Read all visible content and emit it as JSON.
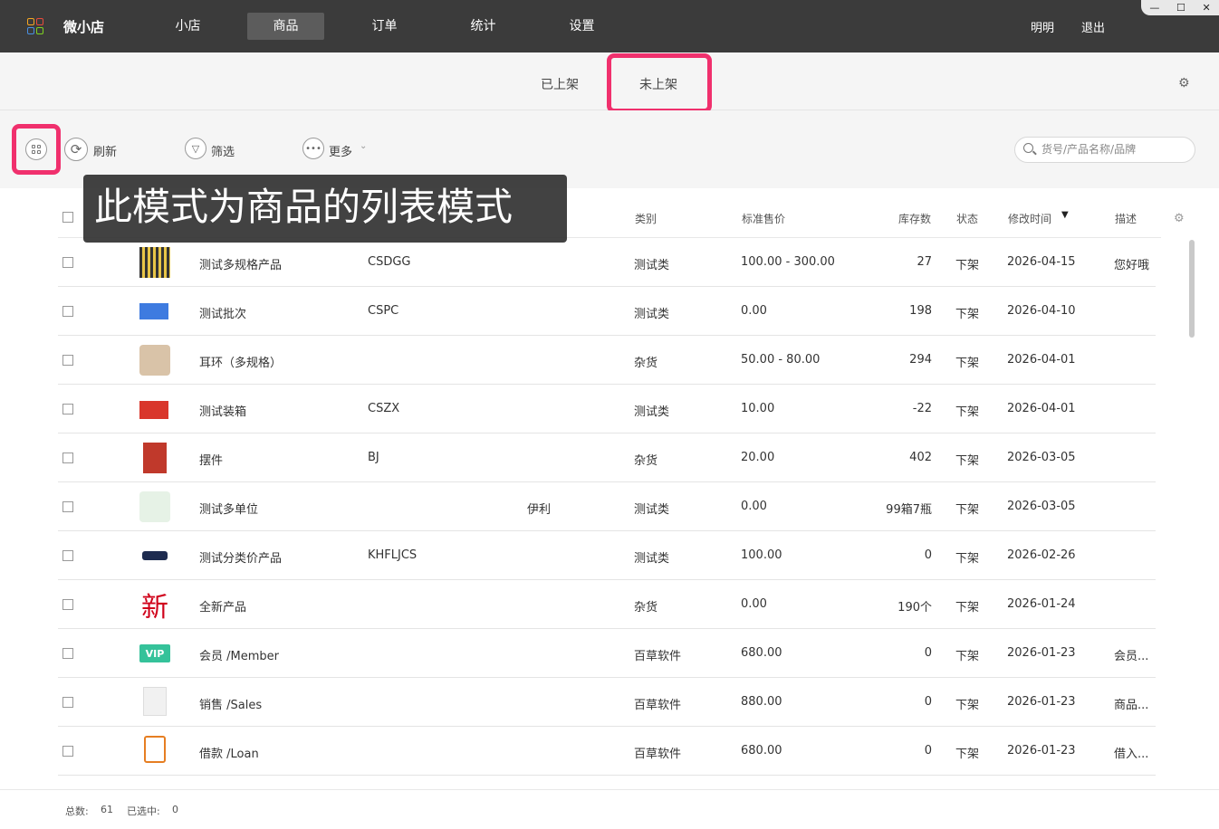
{
  "app": {
    "title": "微小店"
  },
  "nav": [
    {
      "label": "小店"
    },
    {
      "label": "商品",
      "active": true
    },
    {
      "label": "订单"
    },
    {
      "label": "统计"
    },
    {
      "label": "设置"
    }
  ],
  "user": {
    "name": "明明",
    "logout": "退出"
  },
  "window_controls": {
    "minimize": "—",
    "maximize": "☐",
    "close": "✕"
  },
  "subtabs": {
    "listed": "已上架",
    "unlisted": "未上架"
  },
  "toolbar": {
    "refresh": "刷新",
    "filter": "筛选",
    "more": "更多",
    "search_placeholder": "货号/产品名称/品牌"
  },
  "tooltip": "此模式为商品的列表模式",
  "columns": {
    "category": "类别",
    "price": "标准售价",
    "stock": "库存数",
    "status": "状态",
    "modified": "修改时间",
    "sort_marker": "▼",
    "desc": "描述"
  },
  "rows": [
    {
      "name": "测试多规格产品",
      "code": "CSDGG",
      "brand": "",
      "category": "测试类",
      "price": "100.00 - 300.00",
      "stock": "27",
      "status": "下架",
      "date": "2026-04-15",
      "desc": "您好哦",
      "thumb": "multi"
    },
    {
      "name": "测试批次",
      "code": "CSPC",
      "brand": "",
      "category": "测试类",
      "price": "0.00",
      "stock": "198",
      "status": "下架",
      "date": "2026-04-10",
      "desc": "",
      "thumb": "batch"
    },
    {
      "name": "耳环（多规格）",
      "code": "",
      "brand": "",
      "category": "杂货",
      "price": "50.00 - 80.00",
      "stock": "294",
      "status": "下架",
      "date": "2026-04-01",
      "desc": "",
      "thumb": "earring"
    },
    {
      "name": "测试装箱",
      "code": "CSZX",
      "brand": "",
      "category": "测试类",
      "price": "10.00",
      "stock": "-22",
      "status": "下架",
      "date": "2026-04-01",
      "desc": "",
      "thumb": "box"
    },
    {
      "name": "摆件",
      "code": "BJ",
      "brand": "",
      "category": "杂货",
      "price": "20.00",
      "stock": "402",
      "status": "下架",
      "date": "2026-03-05",
      "desc": "",
      "thumb": "ornament"
    },
    {
      "name": "测试多单位",
      "code": "",
      "brand": "伊利",
      "category": "测试类",
      "price": "0.00",
      "stock": "99箱7瓶",
      "status": "下架",
      "date": "2026-03-05",
      "desc": "",
      "thumb": "milk"
    },
    {
      "name": "测试分类价产品",
      "code": "KHFLJCS",
      "brand": "",
      "category": "测试类",
      "price": "100.00",
      "stock": "0",
      "status": "下架",
      "date": "2026-02-26",
      "desc": "",
      "thumb": "logo"
    },
    {
      "name": "全新产品",
      "code": "",
      "brand": "",
      "category": "杂货",
      "price": "0.00",
      "stock": "190个",
      "status": "下架",
      "date": "2026-01-24",
      "desc": "",
      "thumb": "new"
    },
    {
      "name": "会员 /Member",
      "code": "",
      "brand": "",
      "category": "百草软件",
      "price": "680.00",
      "stock": "0",
      "status": "下架",
      "date": "2026-01-23",
      "desc": "会员...",
      "thumb": "vip"
    },
    {
      "name": "销售 /Sales",
      "code": "",
      "brand": "",
      "category": "百草软件",
      "price": "880.00",
      "stock": "0",
      "status": "下架",
      "date": "2026-01-23",
      "desc": "商品...",
      "thumb": "sales"
    },
    {
      "name": "借款 /Loan",
      "code": "",
      "brand": "",
      "category": "百草软件",
      "price": "680.00",
      "stock": "0",
      "status": "下架",
      "date": "2026-01-23",
      "desc": "借入...",
      "thumb": "loan"
    }
  ],
  "thumbs": {
    "new_char": "新",
    "vip": "VIP"
  },
  "footer": {
    "total_label": "总数:",
    "total": "61",
    "selected_label": "已选中:",
    "selected": "0"
  },
  "colors": {
    "highlight": "#f0306d",
    "topbar": "#3b3b3b"
  }
}
